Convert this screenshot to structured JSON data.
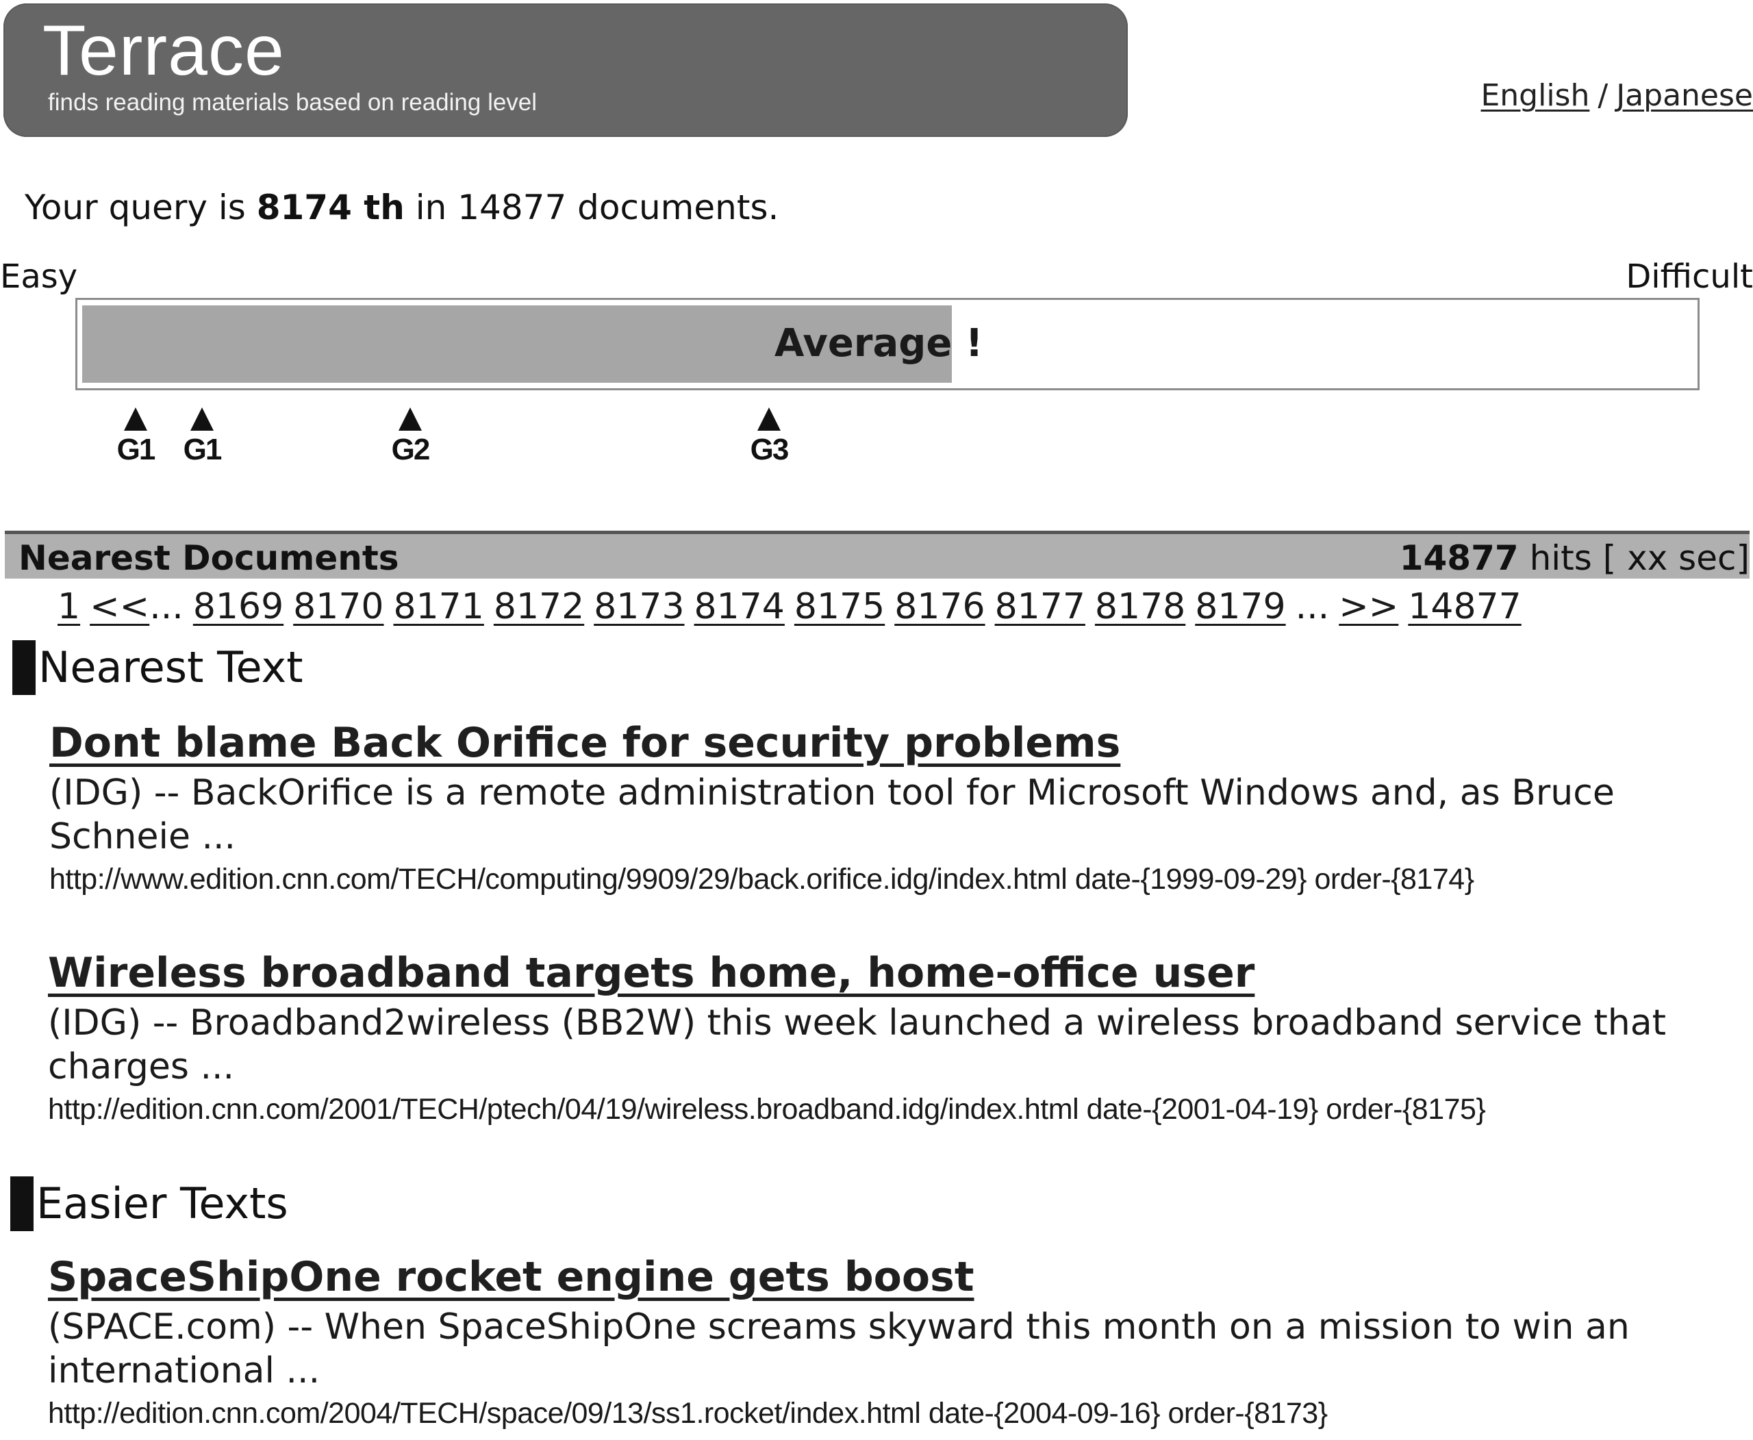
{
  "header": {
    "title": "Terrace",
    "subtitle": "finds reading materials based on reading level",
    "languages": [
      {
        "label": "English"
      },
      {
        "label": "Japanese"
      }
    ],
    "language_separator": "/",
    "background_color": "#666666"
  },
  "query_summary": {
    "prefix": "Your query is",
    "rank": "8174 th",
    "middle": "in",
    "total": "14877",
    "suffix": "documents."
  },
  "level_scale": {
    "easy_label": "Easy",
    "difficult_label": "Difficult",
    "level_label": "Average",
    "level_suffix": "!",
    "rank": 8174,
    "total": 14877,
    "fill_fraction": 0.54,
    "fill_color": "#a6a6a6",
    "markers": [
      {
        "label": "G1",
        "position_fraction": 0.037
      },
      {
        "label": "G1",
        "position_fraction": 0.078
      },
      {
        "label": "G2",
        "position_fraction": 0.206
      },
      {
        "label": "G3",
        "position_fraction": 0.427
      }
    ]
  },
  "results_band": {
    "title": "Nearest Documents",
    "hits_count": "14877",
    "hits_label": "hits [ xx sec]"
  },
  "pagination": {
    "first": "1",
    "prev": "<<",
    "pages": [
      "8169",
      "8170",
      "8171",
      "8172",
      "8173",
      "8174",
      "8175",
      "8176",
      "8177",
      "8178",
      "8179"
    ],
    "ellipsis": "...",
    "next": ">>",
    "last": "14877"
  },
  "sections": [
    {
      "heading": "Nearest Text",
      "results": [
        {
          "title": "Dont blame Back Orifice for security problems",
          "snippet": "(IDG) -- BackOrifice is a remote administration tool for Microsoft Windows and, as Bruce Schneie ...",
          "url": "http://www.edition.cnn.com/TECH/computing/9909/29/back.orifice.idg/index.html",
          "date": "date-{1999-09-29}",
          "order": "order-{8174}"
        },
        {
          "title": "Wireless broadband targets home, home-office user",
          "snippet": "(IDG) -- Broadband2wireless (BB2W) this week launched a wireless broadband service that charges ...",
          "url": "http://edition.cnn.com/2001/TECH/ptech/04/19/wireless.broadband.idg/index.html",
          "date": "date-{2001-04-19}",
          "order": "order-{8175}"
        }
      ]
    },
    {
      "heading": "Easier Texts",
      "results": [
        {
          "title": "SpaceShipOne rocket engine gets boost",
          "snippet": "(SPACE.com) -- When SpaceShipOne screams skyward this month on a mission to win an international ...",
          "url": "http://edition.cnn.com/2004/TECH/space/09/13/ss1.rocket/index.html",
          "date": "date-{2004-09-16}",
          "order": "order-{8173}"
        }
      ]
    }
  ]
}
